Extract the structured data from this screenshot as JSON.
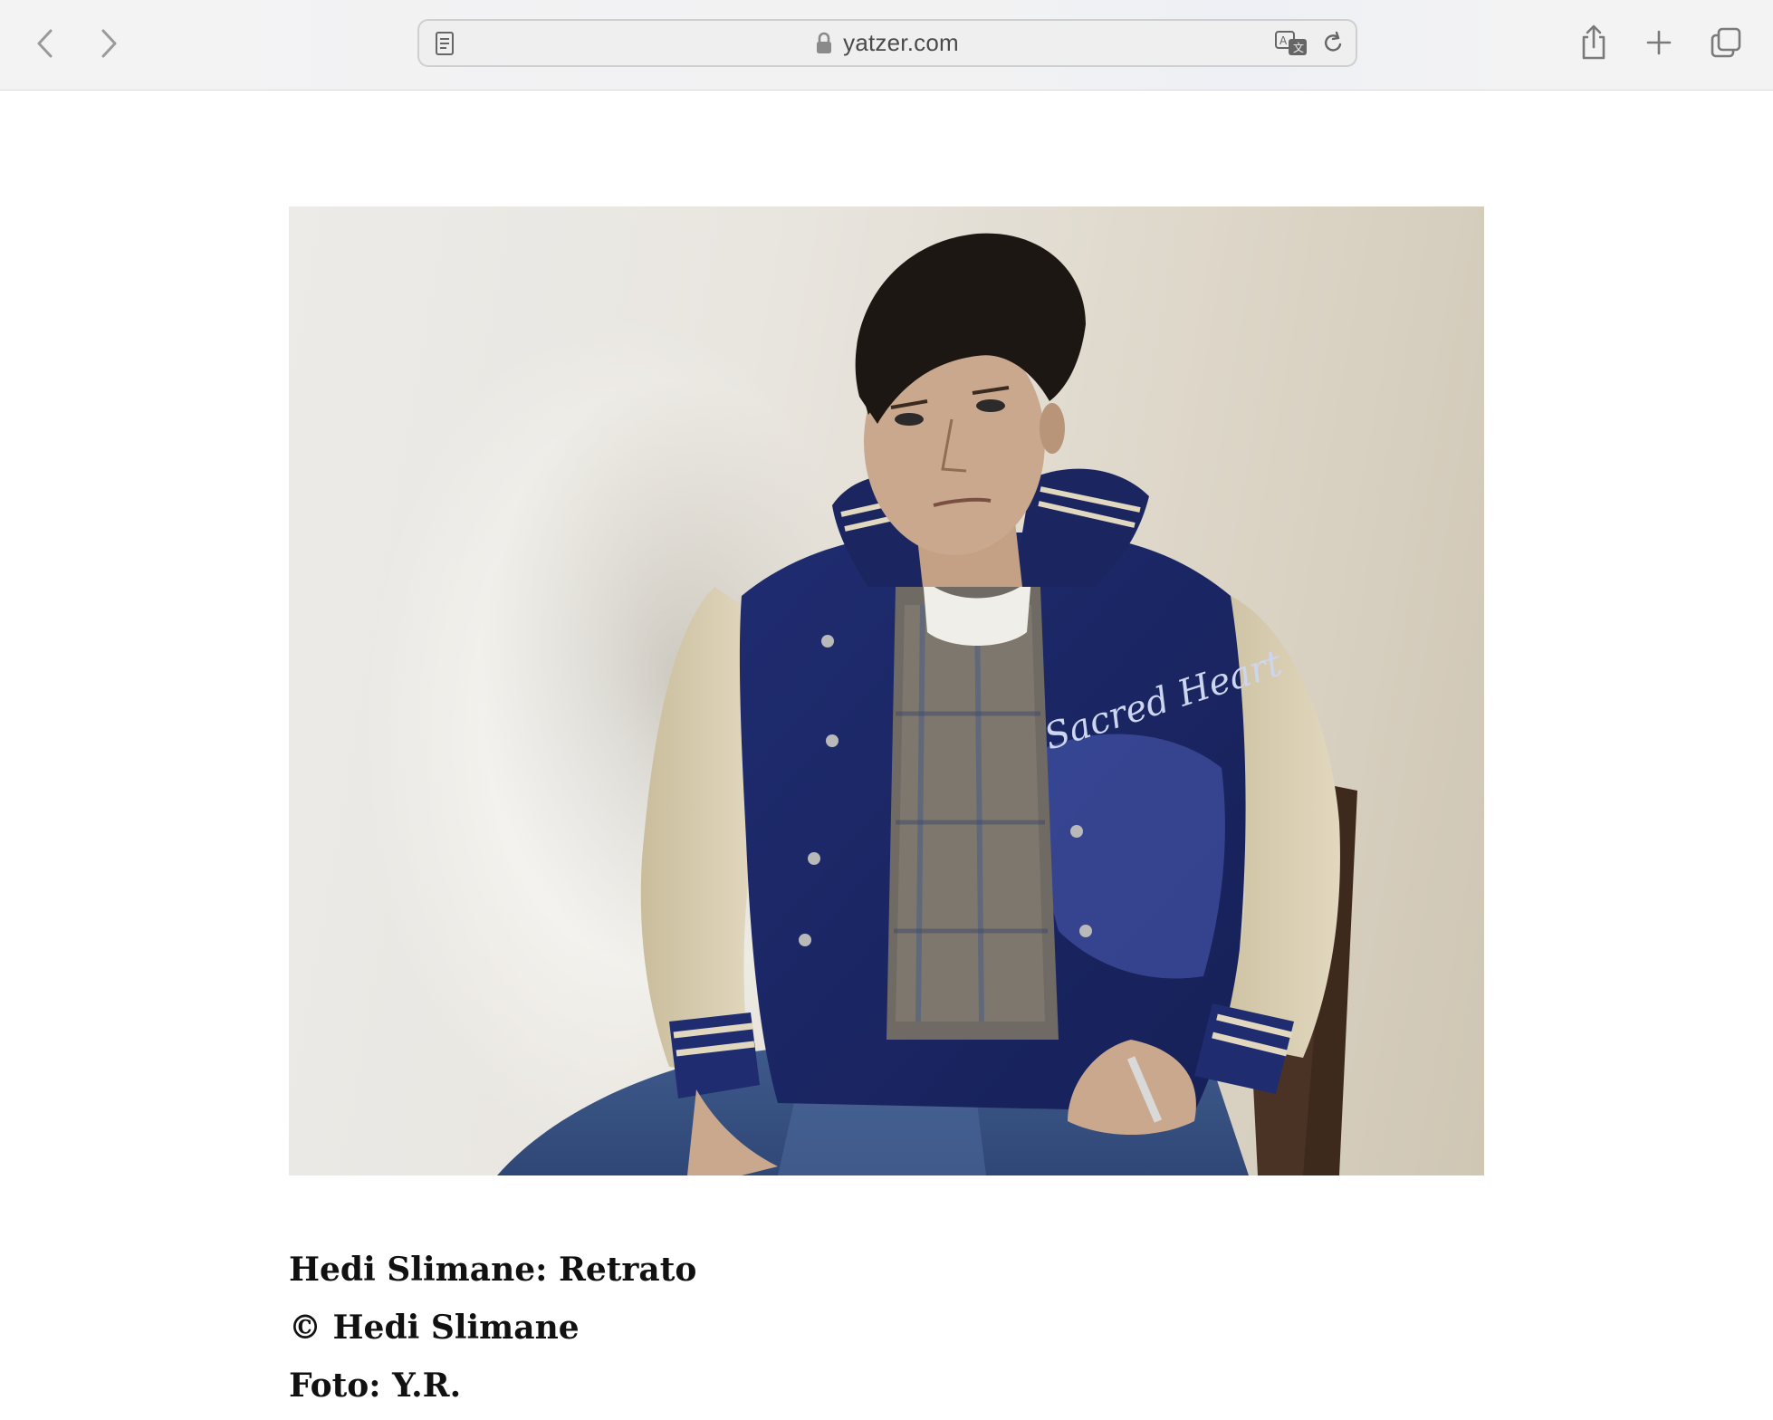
{
  "browser": {
    "url": "yatzer.com",
    "icons": {
      "back": "chevron-left-icon",
      "forward": "chevron-right-icon",
      "reader": "reader-view-icon",
      "lock": "lock-icon",
      "translate": "translate-icon",
      "reload": "reload-icon",
      "share": "share-icon",
      "new_tab": "plus-icon",
      "tabs": "tab-overview-icon"
    }
  },
  "article": {
    "image": {
      "subject": "portrait photograph",
      "jacket_lettering": "Sacred Heart"
    },
    "caption_lines": [
      "Hedi Slimane: Retrato",
      "© Hedi Slimane",
      "Foto: Y.R."
    ]
  },
  "colors": {
    "toolbar_bg": "#f3f3f4",
    "address_bg": "#efefef",
    "page_bg": "#ffffff",
    "caption_text": "#111111",
    "jacket_navy": "#1d2a6b",
    "sleeve_beige": "#d8ccad"
  }
}
